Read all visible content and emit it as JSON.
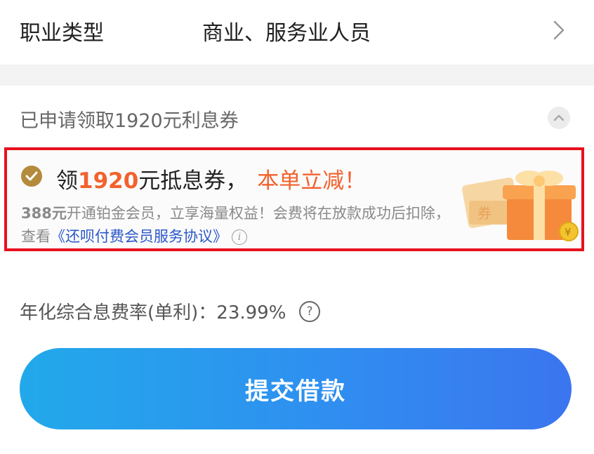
{
  "occupation": {
    "label": "职业类型",
    "value": "商业、服务业人员"
  },
  "coupon_section": {
    "applied_text": "已申请领取1920元利息券",
    "title_prefix": "领",
    "title_amount": "1920",
    "title_suffix": "元抵息券，",
    "title_promo": "本单立减！",
    "desc_price": "388元",
    "desc_text": "开通铂金会员，立享海量权益！会费将在放款成功后扣除，查看",
    "desc_link": "《还呗付费会员服务协议》",
    "info_glyph": "i",
    "gift_glyph": "券",
    "coin_glyph": "¥"
  },
  "rate": {
    "text": "年化综合息费率(单利)：23.99%",
    "help_glyph": "?"
  },
  "submit": {
    "label": "提交借款"
  },
  "colors": {
    "accent_orange": "#f2622d",
    "link_blue": "#2a57c9",
    "highlight_red": "#e8101e",
    "check_gold": "#b48a3c"
  },
  "icons": [
    "chevron-right-icon",
    "chevron-up-icon",
    "check-circle-icon",
    "info-icon",
    "question-icon",
    "gift-coupon-icon"
  ]
}
